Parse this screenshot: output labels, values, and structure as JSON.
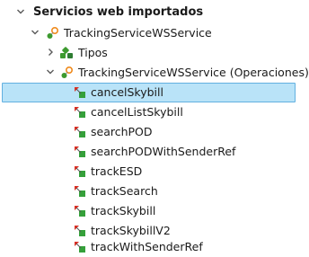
{
  "tree": {
    "section": {
      "label": "Servicios web importados",
      "expanded": true
    },
    "service": {
      "label": "TrackingServiceWSService",
      "expanded": true
    },
    "types": {
      "label": "Tipos",
      "expanded": false
    },
    "operations_group": {
      "label": "TrackingServiceWSService (Operaciones)",
      "expanded": true
    },
    "operations": [
      {
        "label": "cancelSkybill",
        "selected": true
      },
      {
        "label": "cancelListSkybill",
        "selected": false
      },
      {
        "label": "searchPOD",
        "selected": false
      },
      {
        "label": "searchPODWithSenderRef",
        "selected": false
      },
      {
        "label": "trackESD",
        "selected": false
      },
      {
        "label": "trackSearch",
        "selected": false
      },
      {
        "label": "trackSkybill",
        "selected": false
      },
      {
        "label": "trackSkybillV2",
        "selected": false
      },
      {
        "label": "trackWithSenderRef",
        "selected": false
      }
    ]
  },
  "colors": {
    "selection_fill": "#b9e3f8",
    "selection_border": "#62b0e0",
    "chevron": "#5a5a5a",
    "service_icon_green": "#3d9a2f",
    "service_icon_orange": "#f08a1c",
    "operation_icon_red": "#d93025",
    "operation_icon_green": "#35a03a"
  }
}
